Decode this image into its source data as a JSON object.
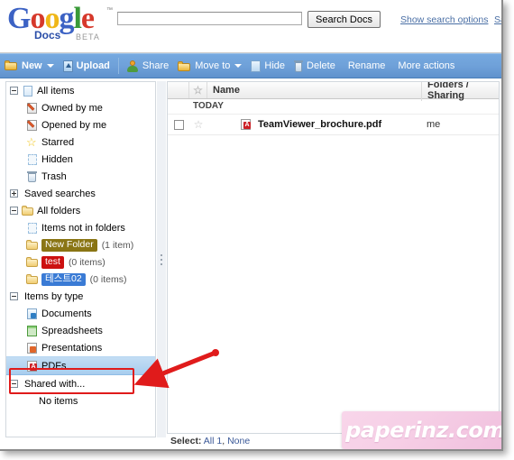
{
  "header": {
    "logo": {
      "word": "Google",
      "tm": "™",
      "sub": "Docs",
      "beta": "BETA"
    },
    "search": {
      "value": "",
      "placeholder": "",
      "button_label": "Search Docs"
    },
    "links": [
      {
        "label": "Show search options"
      },
      {
        "label": "Sa"
      }
    ]
  },
  "toolbar": {
    "items": [
      {
        "label": "New",
        "icon": "new-folder-icon",
        "caret": true,
        "bold": true
      },
      {
        "label": "Upload",
        "icon": "upload-icon",
        "caret": false,
        "bold": true
      },
      {
        "label": "Share",
        "icon": "share-icon",
        "caret": false,
        "bold": false
      },
      {
        "label": "Move to",
        "icon": "move-folder-icon",
        "caret": true,
        "bold": false
      },
      {
        "label": "Hide",
        "icon": "hide-icon",
        "caret": false,
        "bold": false
      },
      {
        "label": "Delete",
        "icon": "trash-icon",
        "caret": false,
        "bold": false
      },
      {
        "label": "Rename",
        "icon": "",
        "caret": false,
        "bold": false
      },
      {
        "label": "More actions",
        "icon": "",
        "caret": false,
        "bold": false
      }
    ]
  },
  "sidebar": {
    "groups": [
      {
        "header": {
          "label": "All items",
          "icon": "document-icon",
          "toggle": "minus",
          "indent": 0
        },
        "items": [
          {
            "label": "Owned by me",
            "icon": "pencil-doc-icon",
            "indent": 1
          },
          {
            "label": "Opened by me",
            "icon": "pencil-doc-icon",
            "indent": 1
          },
          {
            "label": "Starred",
            "icon": "star-icon",
            "indent": 1
          },
          {
            "label": "Hidden",
            "icon": "hidden-doc-icon",
            "indent": 1
          },
          {
            "label": "Trash",
            "icon": "trash-icon",
            "indent": 1
          }
        ]
      },
      {
        "header": {
          "label": "Saved searches",
          "icon": "",
          "toggle": "plus",
          "indent": 0
        },
        "items": []
      },
      {
        "header": {
          "label": "All folders",
          "icon": "folder-icon",
          "toggle": "minus",
          "indent": 0
        },
        "items": [
          {
            "label": "Items not in folders",
            "icon": "document-icon",
            "indent": 1
          },
          {
            "label": "New Folder",
            "icon": "folder-icon",
            "indent": 1,
            "tag_color": "#8a7514",
            "count": "(1 item)"
          },
          {
            "label": "test",
            "icon": "folder-icon",
            "indent": 1,
            "tag_color": "#cc1111",
            "count": "(0 items)"
          },
          {
            "label": "테스트02",
            "icon": "folder-icon",
            "indent": 1,
            "tag_color": "#3a7bd5",
            "count": "(0 items)"
          }
        ]
      },
      {
        "header": {
          "label": "Items by type",
          "icon": "",
          "toggle": "minus",
          "indent": 0
        },
        "items": [
          {
            "label": "Documents",
            "icon": "documents-type-icon",
            "indent": 1
          },
          {
            "label": "Spreadsheets",
            "icon": "spreadsheet-icon",
            "indent": 1
          },
          {
            "label": "Presentations",
            "icon": "presentation-icon",
            "indent": 1
          },
          {
            "label": "PDFs",
            "icon": "pdf-icon",
            "indent": 1,
            "selected": true
          }
        ]
      },
      {
        "header": {
          "label": "Shared with...",
          "icon": "",
          "toggle": "minus",
          "indent": 0
        },
        "items": [
          {
            "label": "No items",
            "icon": "",
            "indent": 2
          }
        ]
      }
    ]
  },
  "main": {
    "columns": {
      "name": "Name",
      "sharing": "Folders / Sharing",
      "star": "star-icon"
    },
    "groups": [
      {
        "label": "TODAY",
        "rows": [
          {
            "name": "TeamViewer_brochure.pdf",
            "icon": "pdf-icon",
            "sharing": "me",
            "checked": false,
            "starred": false
          }
        ]
      }
    ]
  },
  "status": {
    "label": "Select:",
    "all_link": "All 1",
    "separator": ",",
    "none_link": "None"
  },
  "watermark": {
    "text": "paperinz.com"
  },
  "annotations": {
    "highlight_box": {
      "target": "PDFs",
      "color": "#e01b1b"
    },
    "arrow": {
      "color": "#e01b1b",
      "points_to": "PDFs"
    }
  }
}
